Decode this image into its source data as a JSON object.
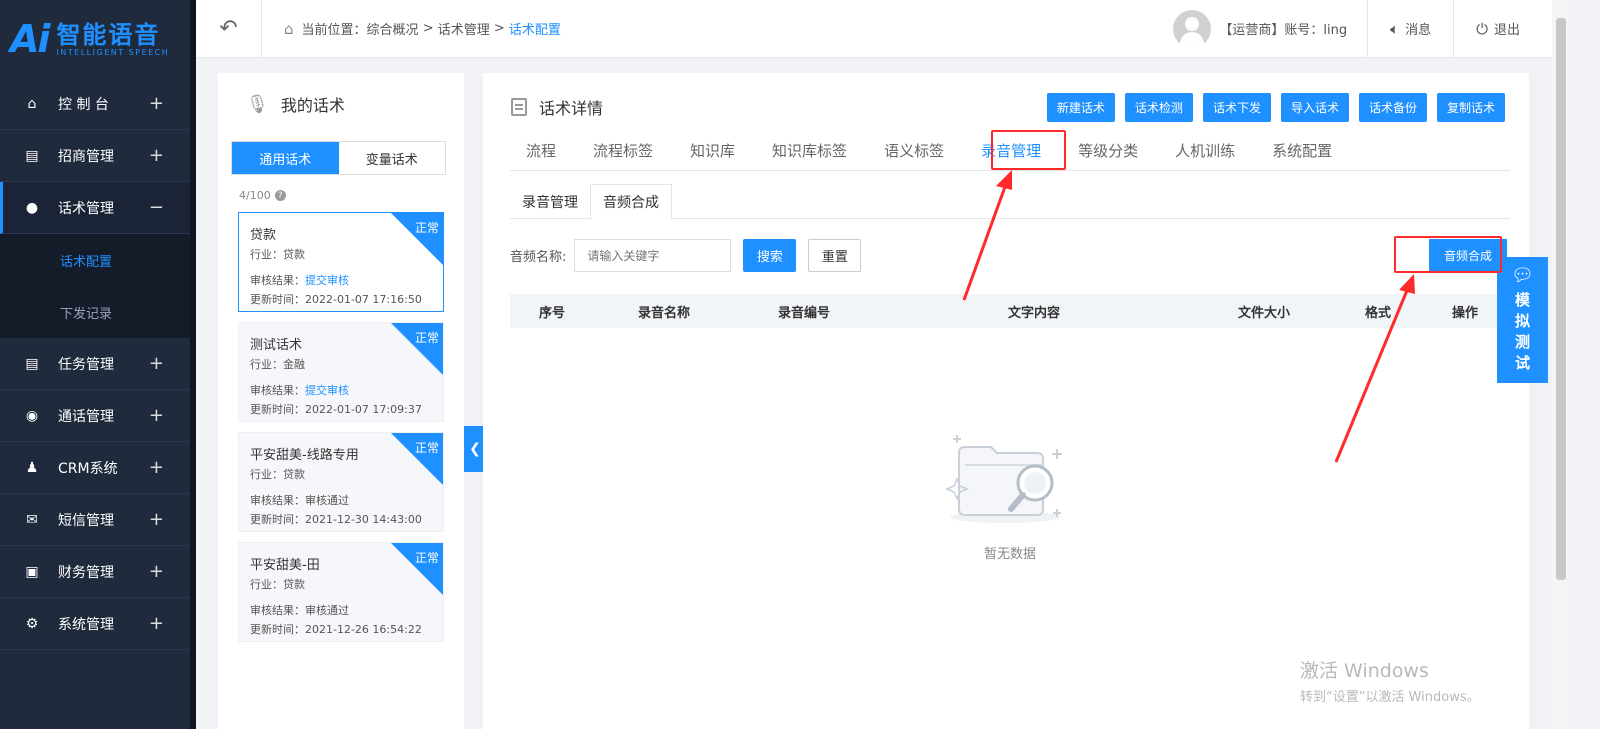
{
  "logo": {
    "mark": "Ai",
    "name": "智能语音",
    "sub": "INTELLIGENT SPEECH"
  },
  "sidebar": {
    "items": [
      {
        "label": "控 制 台",
        "icon": "home-icon",
        "glyph": "⌂",
        "toggle": "+"
      },
      {
        "label": "招商管理",
        "icon": "clipboard-icon",
        "glyph": "▤",
        "toggle": "+"
      },
      {
        "label": "话术管理",
        "icon": "microphone-icon",
        "glyph": "●",
        "toggle": "−"
      },
      {
        "label": "任务管理",
        "icon": "clipboard-check-icon",
        "glyph": "▤",
        "toggle": "+"
      },
      {
        "label": "通话管理",
        "icon": "phone-icon",
        "glyph": "◉",
        "toggle": "+"
      },
      {
        "label": "CRM系统",
        "icon": "user-icon",
        "glyph": "♟",
        "toggle": "+"
      },
      {
        "label": "短信管理",
        "icon": "mail-icon",
        "glyph": "✉",
        "toggle": "+"
      },
      {
        "label": "财务管理",
        "icon": "wallet-icon",
        "glyph": "▣",
        "toggle": "+"
      },
      {
        "label": "系统管理",
        "icon": "gear-icon",
        "glyph": "⚙",
        "toggle": "+"
      }
    ],
    "submenu": [
      {
        "label": "话术配置",
        "active": true
      },
      {
        "label": "下发记录",
        "active": false
      }
    ]
  },
  "header": {
    "breadcrumb_prefix": "当前位置：",
    "crumb1": "综合概况",
    "sep": " > ",
    "crumb2": "话术管理",
    "crumb3": "话术配置",
    "account": "【运营商】账号：ling",
    "messages": "消息",
    "logout": "退出"
  },
  "left_panel": {
    "title": "我的话术",
    "tab_general": "通用话术",
    "tab_variable": "变量话术",
    "count": "4/100",
    "help": "?",
    "cards": [
      {
        "title": "贷款",
        "industry": "行业：贷款",
        "audit_label": "审核结果：",
        "audit_value": "提交审核",
        "audit_link": true,
        "updated": "更新时间：2022-01-07 17:16:50",
        "status": "正常"
      },
      {
        "title": "测试话术",
        "industry": "行业：金融",
        "audit_label": "审核结果：",
        "audit_value": "提交审核",
        "audit_link": true,
        "updated": "更新时间：2022-01-07 17:09:37",
        "status": "正常"
      },
      {
        "title": "平安甜美-线路专用",
        "industry": "行业：贷款",
        "audit_label": "审核结果：",
        "audit_value": "审核通过",
        "audit_link": false,
        "updated": "更新时间：2021-12-30 14:43:00",
        "status": "正常"
      },
      {
        "title": "平安甜美-田",
        "industry": "行业：贷款",
        "audit_label": "审核结果：",
        "audit_value": "审核通过",
        "audit_link": false,
        "updated": "更新时间：2021-12-26 16:54:22",
        "status": "正常"
      }
    ]
  },
  "main": {
    "title": "话术详情",
    "actions": [
      "新建话术",
      "话术检测",
      "话术下发",
      "导入话术",
      "话术备份",
      "复制话术"
    ],
    "tabs": [
      "流程",
      "流程标签",
      "知识库",
      "知识库标签",
      "语义标签",
      "录音管理",
      "等级分类",
      "人机训练",
      "系统配置"
    ],
    "active_tab": 5,
    "subtabs": [
      "录音管理",
      "音频合成"
    ],
    "search_label": "音频名称:",
    "search_placeholder": "请输入关键字",
    "search_btn": "搜索",
    "reset_btn": "重置",
    "synth_btn": "音频合成",
    "columns": [
      "序号",
      "录音名称",
      "录音编号",
      "文字内容",
      "文件大小",
      "格式",
      "操作"
    ],
    "empty_text": "暂无数据"
  },
  "float_test": {
    "label": "模拟测试"
  },
  "watermark": {
    "line1": "激活 Windows",
    "line2": "转到“设置”以激活 Windows。"
  },
  "colors": {
    "primary": "#1e90ff",
    "sidebar": "#1f2a3d",
    "highlight": "#ff2a2a"
  }
}
